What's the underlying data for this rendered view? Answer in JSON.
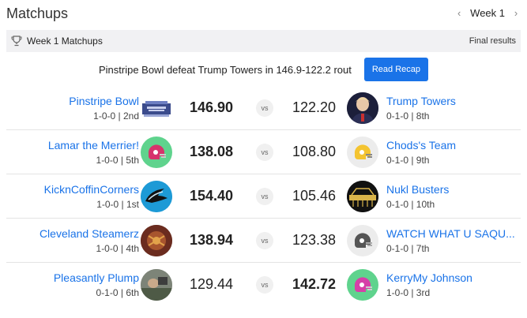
{
  "header": {
    "title": "Matchups",
    "week_label": "Week 1"
  },
  "subbar": {
    "title": "Week 1 Matchups",
    "status": "Final results"
  },
  "recap": {
    "text": "Pinstripe Bowl defeat Trump Towers in 146.9-122.2 rout",
    "button_label": "Read Recap"
  },
  "vs_label": "vs",
  "matchups": [
    {
      "left": {
        "name": "Pinstripe Bowl",
        "record": "1-0-0 | 2nd",
        "score": "146.90",
        "winner": true,
        "avatar": "pinstripe-bowl-logo"
      },
      "right": {
        "name": "Trump Towers",
        "record": "0-1-0 | 8th",
        "score": "122.20",
        "winner": false,
        "avatar": "person-photo"
      }
    },
    {
      "left": {
        "name": "Lamar the Merrier!",
        "record": "1-0-0 | 5th",
        "score": "138.08",
        "winner": true,
        "avatar": "helmet-icon"
      },
      "right": {
        "name": "Chods's Team",
        "record": "0-1-0 | 9th",
        "score": "108.80",
        "winner": false,
        "avatar": "helmet-icon"
      }
    },
    {
      "left": {
        "name": "KicknCoffinCorners",
        "record": "1-0-0 | 1st",
        "score": "154.40",
        "winner": true,
        "avatar": "panther-logo"
      },
      "right": {
        "name": "Nukl Busters",
        "record": "0-1-0 | 10th",
        "score": "105.46",
        "winner": false,
        "avatar": "steel-curtain-logo"
      }
    },
    {
      "left": {
        "name": "Cleveland Steamerz",
        "record": "1-0-0 | 4th",
        "score": "138.94",
        "winner": true,
        "avatar": "team-photo"
      },
      "right": {
        "name": "WATCH WHAT U SAQU...",
        "record": "0-1-0 | 7th",
        "score": "123.38",
        "winner": false,
        "avatar": "helmet-icon"
      }
    },
    {
      "left": {
        "name": "Pleasantly Plump",
        "record": "0-1-0 | 6th",
        "score": "129.44",
        "winner": false,
        "avatar": "team-photo"
      },
      "right": {
        "name": "KerryMy Johnson",
        "record": "1-0-0 | 3rd",
        "score": "142.72",
        "winner": true,
        "avatar": "helmet-icon"
      }
    }
  ],
  "colors": {
    "link": "#1a73e8",
    "button": "#1a73e8",
    "subbar_bg": "#f1f1f3",
    "helmet_green_bg": "#5fd38d",
    "helmet_pink": "#d6336c",
    "helmet_yellow": "#f4c430",
    "helmet_gray": "#555555"
  }
}
